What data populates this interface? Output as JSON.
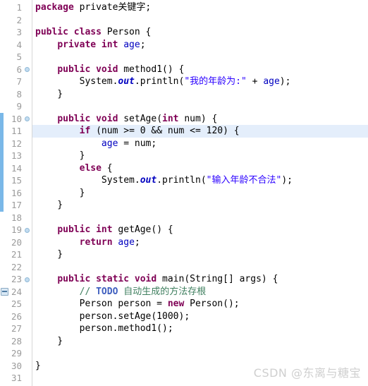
{
  "editor": {
    "language": "java",
    "first_line": 1,
    "line_height": 17.5,
    "current_line": 11,
    "change_bar": {
      "from_line": 10,
      "to_line": 17,
      "color": "#7ab8e8"
    },
    "highlight_color": "#e4eefb",
    "colors": {
      "keyword": "#7f0055",
      "string": "#2a00ff",
      "comment": "#3f7f5f",
      "todo_tag": "#3f5fbf",
      "field": "#0000c0",
      "line_number": "#9a9a9a",
      "background": "#ffffff"
    },
    "fold_marker_lines": [
      6,
      10,
      19,
      23
    ],
    "todo_marker_lines": [
      24
    ],
    "lines": [
      {
        "n": 1,
        "tokens": [
          {
            "t": "package",
            "c": "kw"
          },
          {
            "t": " private关键字;",
            "c": "pl"
          }
        ]
      },
      {
        "n": 2,
        "tokens": []
      },
      {
        "n": 3,
        "tokens": [
          {
            "t": "public class",
            "c": "kw"
          },
          {
            "t": " Person {",
            "c": "pl"
          }
        ]
      },
      {
        "n": 4,
        "tokens": [
          {
            "t": "    ",
            "c": "pl"
          },
          {
            "t": "private int",
            "c": "kw"
          },
          {
            "t": " ",
            "c": "pl"
          },
          {
            "t": "age",
            "c": "fld"
          },
          {
            "t": ";",
            "c": "pl"
          }
        ]
      },
      {
        "n": 5,
        "tokens": []
      },
      {
        "n": 6,
        "tokens": [
          {
            "t": "    ",
            "c": "pl"
          },
          {
            "t": "public void",
            "c": "kw"
          },
          {
            "t": " method1() {",
            "c": "pl"
          }
        ]
      },
      {
        "n": 7,
        "tokens": [
          {
            "t": "        System.",
            "c": "pl"
          },
          {
            "t": "out",
            "c": "sfld"
          },
          {
            "t": ".println(",
            "c": "pl"
          },
          {
            "t": "\"我的年龄为:\"",
            "c": "str"
          },
          {
            "t": " + ",
            "c": "pl"
          },
          {
            "t": "age",
            "c": "fld"
          },
          {
            "t": ");",
            "c": "pl"
          }
        ]
      },
      {
        "n": 8,
        "tokens": [
          {
            "t": "    }",
            "c": "pl"
          }
        ]
      },
      {
        "n": 9,
        "tokens": []
      },
      {
        "n": 10,
        "tokens": [
          {
            "t": "    ",
            "c": "pl"
          },
          {
            "t": "public void",
            "c": "kw"
          },
          {
            "t": " setAge(",
            "c": "pl"
          },
          {
            "t": "int",
            "c": "kw"
          },
          {
            "t": " num) {",
            "c": "pl"
          }
        ]
      },
      {
        "n": 11,
        "tokens": [
          {
            "t": "        ",
            "c": "pl"
          },
          {
            "t": "if",
            "c": "kw"
          },
          {
            "t": " (num >= 0 && num <= 120) {",
            "c": "pl"
          }
        ]
      },
      {
        "n": 12,
        "tokens": [
          {
            "t": "            ",
            "c": "pl"
          },
          {
            "t": "age",
            "c": "fld"
          },
          {
            "t": " = num;",
            "c": "pl"
          }
        ]
      },
      {
        "n": 13,
        "tokens": [
          {
            "t": "        }",
            "c": "pl"
          }
        ]
      },
      {
        "n": 14,
        "tokens": [
          {
            "t": "        ",
            "c": "pl"
          },
          {
            "t": "else",
            "c": "kw"
          },
          {
            "t": " {",
            "c": "pl"
          }
        ]
      },
      {
        "n": 15,
        "tokens": [
          {
            "t": "            System.",
            "c": "pl"
          },
          {
            "t": "out",
            "c": "sfld"
          },
          {
            "t": ".println(",
            "c": "pl"
          },
          {
            "t": "\"输入年龄不合法\"",
            "c": "str"
          },
          {
            "t": ");",
            "c": "pl"
          }
        ]
      },
      {
        "n": 16,
        "tokens": [
          {
            "t": "        }",
            "c": "pl"
          }
        ]
      },
      {
        "n": 17,
        "tokens": [
          {
            "t": "    }",
            "c": "pl"
          }
        ]
      },
      {
        "n": 18,
        "tokens": []
      },
      {
        "n": 19,
        "tokens": [
          {
            "t": "    ",
            "c": "pl"
          },
          {
            "t": "public int",
            "c": "kw"
          },
          {
            "t": " getAge() {",
            "c": "pl"
          }
        ]
      },
      {
        "n": 20,
        "tokens": [
          {
            "t": "        ",
            "c": "pl"
          },
          {
            "t": "return",
            "c": "kw"
          },
          {
            "t": " ",
            "c": "pl"
          },
          {
            "t": "age",
            "c": "fld"
          },
          {
            "t": ";",
            "c": "pl"
          }
        ]
      },
      {
        "n": 21,
        "tokens": [
          {
            "t": "    }",
            "c": "pl"
          }
        ]
      },
      {
        "n": 22,
        "tokens": []
      },
      {
        "n": 23,
        "tokens": [
          {
            "t": "    ",
            "c": "pl"
          },
          {
            "t": "public static void",
            "c": "kw"
          },
          {
            "t": " main(String[] args) {",
            "c": "pl"
          }
        ]
      },
      {
        "n": 24,
        "tokens": [
          {
            "t": "        ",
            "c": "pl"
          },
          {
            "t": "// ",
            "c": "cmt"
          },
          {
            "t": "TODO",
            "c": "todo"
          },
          {
            "t": " 自动生成的方法存根",
            "c": "cmt"
          }
        ]
      },
      {
        "n": 25,
        "tokens": [
          {
            "t": "        Person person = ",
            "c": "pl"
          },
          {
            "t": "new",
            "c": "kw"
          },
          {
            "t": " Person();",
            "c": "pl"
          }
        ]
      },
      {
        "n": 26,
        "tokens": [
          {
            "t": "        person.setAge(1000);",
            "c": "pl"
          }
        ]
      },
      {
        "n": 27,
        "tokens": [
          {
            "t": "        person.method1();",
            "c": "pl"
          }
        ]
      },
      {
        "n": 28,
        "tokens": [
          {
            "t": "    }",
            "c": "pl"
          }
        ]
      },
      {
        "n": 29,
        "tokens": []
      },
      {
        "n": 30,
        "tokens": [
          {
            "t": "}",
            "c": "pl"
          }
        ]
      },
      {
        "n": 31,
        "tokens": []
      }
    ]
  },
  "watermark": {
    "text": "CSDN @东离与糖宝"
  }
}
